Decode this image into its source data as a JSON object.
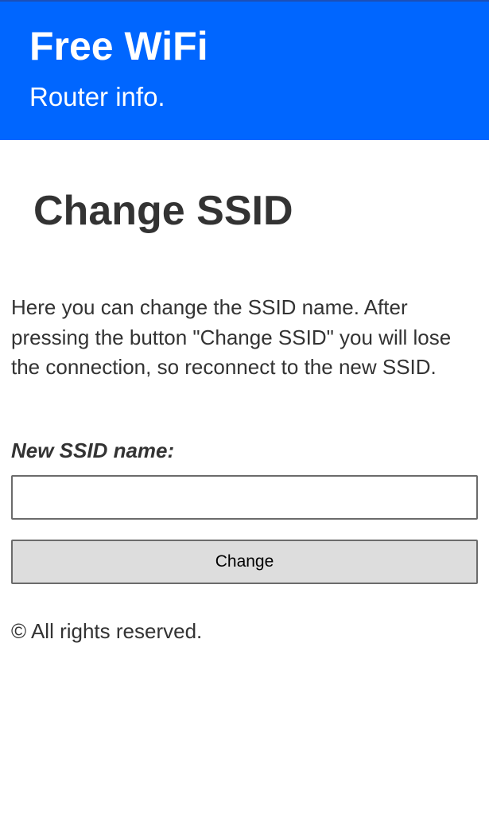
{
  "header": {
    "title": "Free WiFi",
    "subtitle": "Router info."
  },
  "main": {
    "title": "Change SSID",
    "description": "Here you can change the SSID name. After pressing the button \"Change SSID\" you will lose the connection, so reconnect to the new SSID.",
    "field_label": "New SSID name:",
    "ssid_input": {
      "value": "",
      "placeholder": ""
    },
    "button_label": "Change"
  },
  "footer": {
    "copyright": "© All rights reserved."
  },
  "colors": {
    "header_background": "#0066ff",
    "text": "#333333",
    "button_background": "#dddddd",
    "border": "#6b6b6b"
  }
}
